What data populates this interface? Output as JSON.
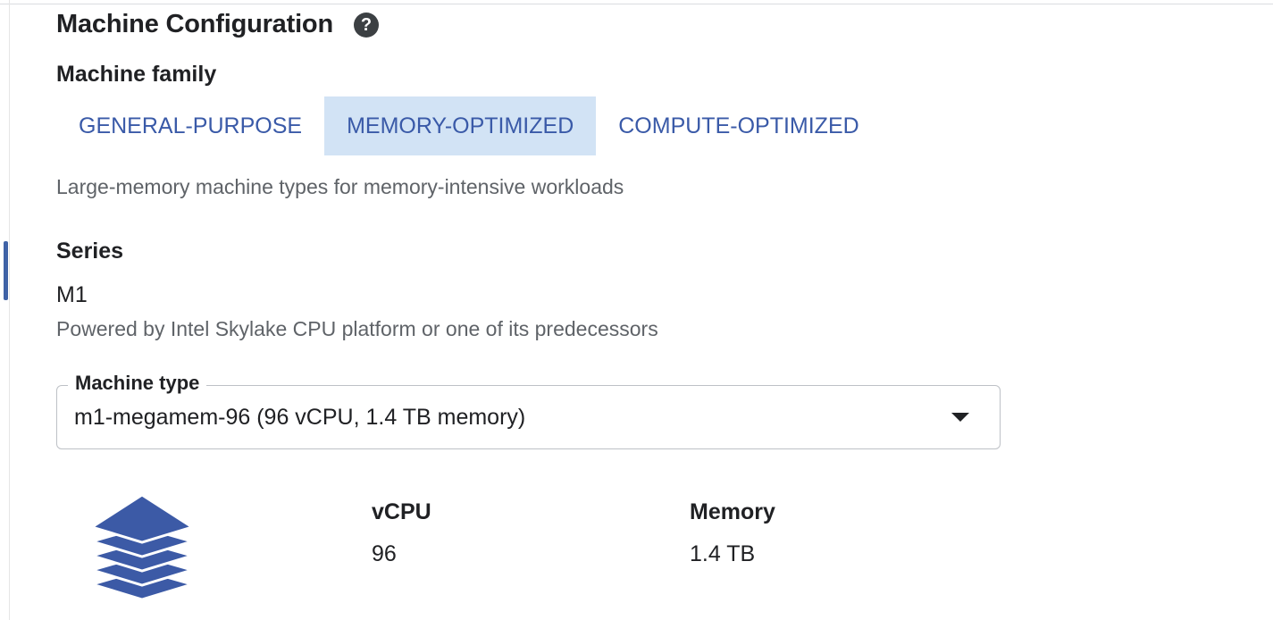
{
  "section": {
    "title": "Machine Configuration",
    "help_icon": "help-icon"
  },
  "machine_family": {
    "heading": "Machine family",
    "tabs": [
      {
        "label": "GENERAL-PURPOSE",
        "selected": false
      },
      {
        "label": "MEMORY-OPTIMIZED",
        "selected": true
      },
      {
        "label": "COMPUTE-OPTIMIZED",
        "selected": false
      }
    ],
    "description": "Large-memory machine types for memory-intensive workloads"
  },
  "series": {
    "heading": "Series",
    "value": "M1",
    "description": "Powered by Intel Skylake CPU platform or one of its predecessors"
  },
  "machine_type": {
    "label": "Machine type",
    "value": "m1-megamem-96 (96 vCPU, 1.4 TB memory)",
    "icon": "chevron-down-icon"
  },
  "specs": {
    "icon": "memory-stack-icon",
    "vcpu_label": "vCPU",
    "vcpu_value": "96",
    "memory_label": "Memory",
    "memory_value": "1.4 TB"
  },
  "colors": {
    "accent": "#3a5aa8",
    "selected_tab_bg": "#d2e3f5",
    "icon_blue": "#3c5aa6"
  }
}
